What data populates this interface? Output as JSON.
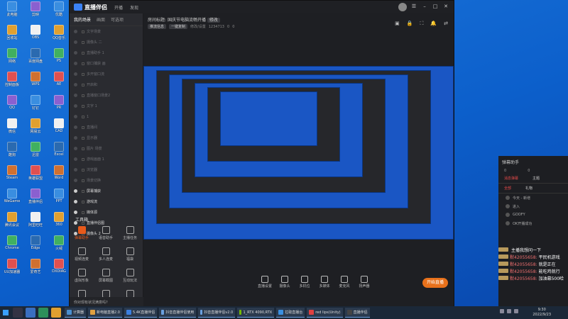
{
  "app": {
    "brand": "直播伴侣",
    "title_tabs": [
      "开播",
      "发现"
    ],
    "room_title_label": "房间标题:",
    "room_title": "国庆节电脑流畅开播",
    "edit_label": "修改",
    "stream_info": [
      "推流信息",
      "一键复制",
      "修改/设置"
    ],
    "room_id": "1234713",
    "likes": "0",
    "viewers": "0"
  },
  "sidebar": {
    "tabs": [
      "我的场景",
      "画面",
      "可选项"
    ],
    "sources": [
      {
        "label": "文字场景"
      },
      {
        "label": "摄像头 二"
      },
      {
        "label": "直播助手 1"
      },
      {
        "label": "窗口捕获 画"
      },
      {
        "label": "多开窗口流"
      },
      {
        "label": "开启和"
      },
      {
        "label": "直播窗口场景2"
      },
      {
        "label": "文字 1"
      },
      {
        "label": "1"
      },
      {
        "label": "直播间"
      },
      {
        "label": "显示器"
      },
      {
        "label": "图片 场景"
      },
      {
        "label": "游戏画面 1"
      },
      {
        "label": "浏览器"
      },
      {
        "label": "场景切换"
      },
      {
        "label": "屏幕捕获"
      },
      {
        "label": "游戏流"
      },
      {
        "label": "媒体源"
      },
      {
        "label": "直播伴侣图"
      },
      {
        "label": "摄像头 2"
      }
    ],
    "tools_title": "工具箱",
    "tools": [
      {
        "label": "弹幕助手",
        "icon": "danmaku-icon",
        "active": true
      },
      {
        "label": "语音助手",
        "icon": "voice-icon"
      },
      {
        "label": "主播任务",
        "icon": "task-icon"
      },
      {
        "label": "视频连麦",
        "icon": "video-link-icon"
      },
      {
        "label": "多人连麦",
        "icon": "multi-link-icon"
      },
      {
        "label": "福袋",
        "icon": "gift-bag-icon"
      },
      {
        "label": "虚拟形象",
        "icon": "avatar-icon"
      },
      {
        "label": "屏幕截图",
        "icon": "screenshot-icon"
      },
      {
        "label": "互动玩法",
        "icon": "game-icon"
      },
      {
        "label": "直播回放",
        "icon": "replay-icon"
      },
      {
        "label": "小游戏",
        "icon": "minigame-icon"
      },
      {
        "label": "更多",
        "icon": "more-icon"
      }
    ],
    "status_text": "你对现有状况满意吗?"
  },
  "bottom_tools": [
    {
      "label": "直播设置",
      "icon": "settings-icon"
    },
    {
      "label": "摄像头",
      "icon": "camera-icon"
    },
    {
      "label": "多机位",
      "icon": "multicam-icon"
    },
    {
      "label": "多媒体",
      "icon": "media-icon"
    },
    {
      "label": "麦克风",
      "icon": "mic-icon"
    },
    {
      "label": "扬声器",
      "icon": "speaker-icon"
    }
  ],
  "go_live_label": "开始直播",
  "chat": {
    "title": "弹幕助手",
    "stats": [
      "0",
      "0"
    ],
    "tabs": [
      "消息弹幕",
      "主题"
    ],
    "tabs2": [
      "全部",
      "礼物"
    ],
    "rows": [
      "今天 - 新增",
      "进入",
      "GOOFY",
      "OK开播成功"
    ]
  },
  "overlay_messages": [
    {
      "user": "",
      "text": "主播我想问一下"
    },
    {
      "user": "默42055658:",
      "text": "平民机游戏"
    },
    {
      "user": "默42055658:",
      "text": "就是正在"
    },
    {
      "user": "默42055658:",
      "text": "能吃鸡就行"
    },
    {
      "user": "默42055658:",
      "text": "加油幕500哈"
    }
  ],
  "desktop_icons": [
    "此电脑",
    "回收站",
    "网络",
    "控制面板",
    "QQ",
    "微信",
    "酷狗",
    "Steam",
    "WeGame",
    "腾讯会议",
    "Chrome",
    "UU加速器",
    "剪映",
    "OBS",
    "百度网盘",
    "WPS",
    "钉钉",
    "网易云",
    "迅雷",
    "英雄联盟",
    "直播伴侣",
    "阿里旺旺",
    "Edge",
    "爱奇艺",
    "优酷",
    "QQ音乐",
    "PS",
    "AE",
    "PR",
    "CAD",
    "Excel",
    "Word",
    "PPT",
    "360",
    "火绒",
    "DXDIAG"
  ],
  "taskbar": {
    "apps": [
      {
        "label": "计算器",
        "color": "#4a8fd0"
      },
      {
        "label": "新电脑直播2.0",
        "color": "#e0a040"
      },
      {
        "label": "5.4K直播伴侣",
        "color": "#3a7fe0"
      },
      {
        "label": "抖音直播伴侣使用",
        "color": "#6aa0e0"
      },
      {
        "label": "抖音直播伴侣v2.0",
        "color": "#6aa0e0"
      },
      {
        "label": "1_RTX 4090,RTX",
        "color": "#76b900"
      },
      {
        "label": "拉取直播台",
        "color": "#3a8fe0"
      },
      {
        "label": "red lips(Unity)",
        "color": "#e04040"
      },
      {
        "label": "直播伴侣",
        "color": "#444"
      }
    ],
    "time": "9:30",
    "date": "2022/9/23"
  },
  "colors": {
    "accent": "#e8711b",
    "desktop": "#1660c4",
    "app_bg": "#26272b"
  }
}
